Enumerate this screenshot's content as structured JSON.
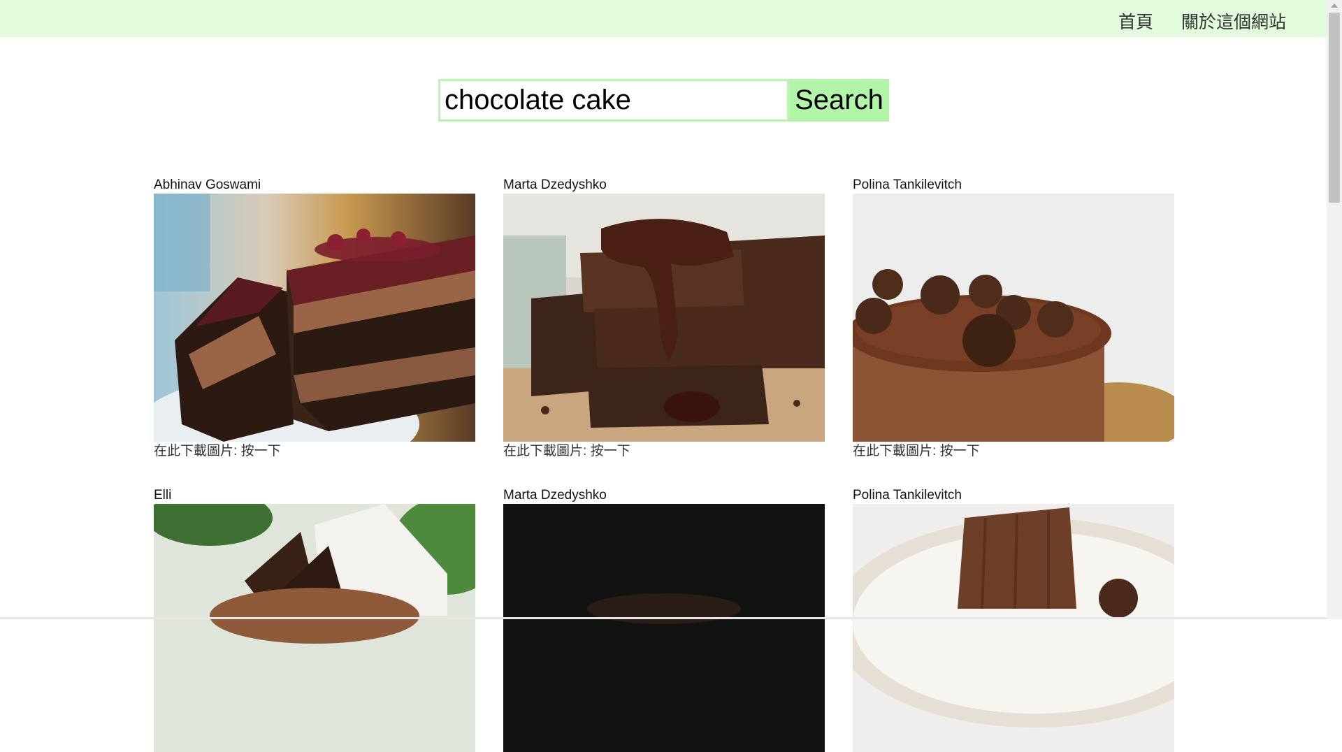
{
  "nav": {
    "home_label": "首頁",
    "about_label": "關於這個網站"
  },
  "search": {
    "value": "chocolate cake",
    "button_label": "Search"
  },
  "results": [
    {
      "author": "Abhinav Goswami",
      "download_text": "在此下載圖片: ",
      "download_link": "按一下"
    },
    {
      "author": "Marta Dzedyshko",
      "download_text": "在此下載圖片: ",
      "download_link": "按一下"
    },
    {
      "author": "Polina Tankilevitch",
      "download_text": "在此下載圖片: ",
      "download_link": "按一下"
    },
    {
      "author": "Elli",
      "download_text": "",
      "download_link": ""
    },
    {
      "author": "Marta Dzedyshko",
      "download_text": "",
      "download_link": ""
    },
    {
      "author": "Polina Tankilevitch",
      "download_text": "",
      "download_link": ""
    }
  ],
  "colors": {
    "header_bg": "#e2fbdc",
    "search_border": "#b9f5b1",
    "search_button_bg": "#b2f5a8"
  }
}
